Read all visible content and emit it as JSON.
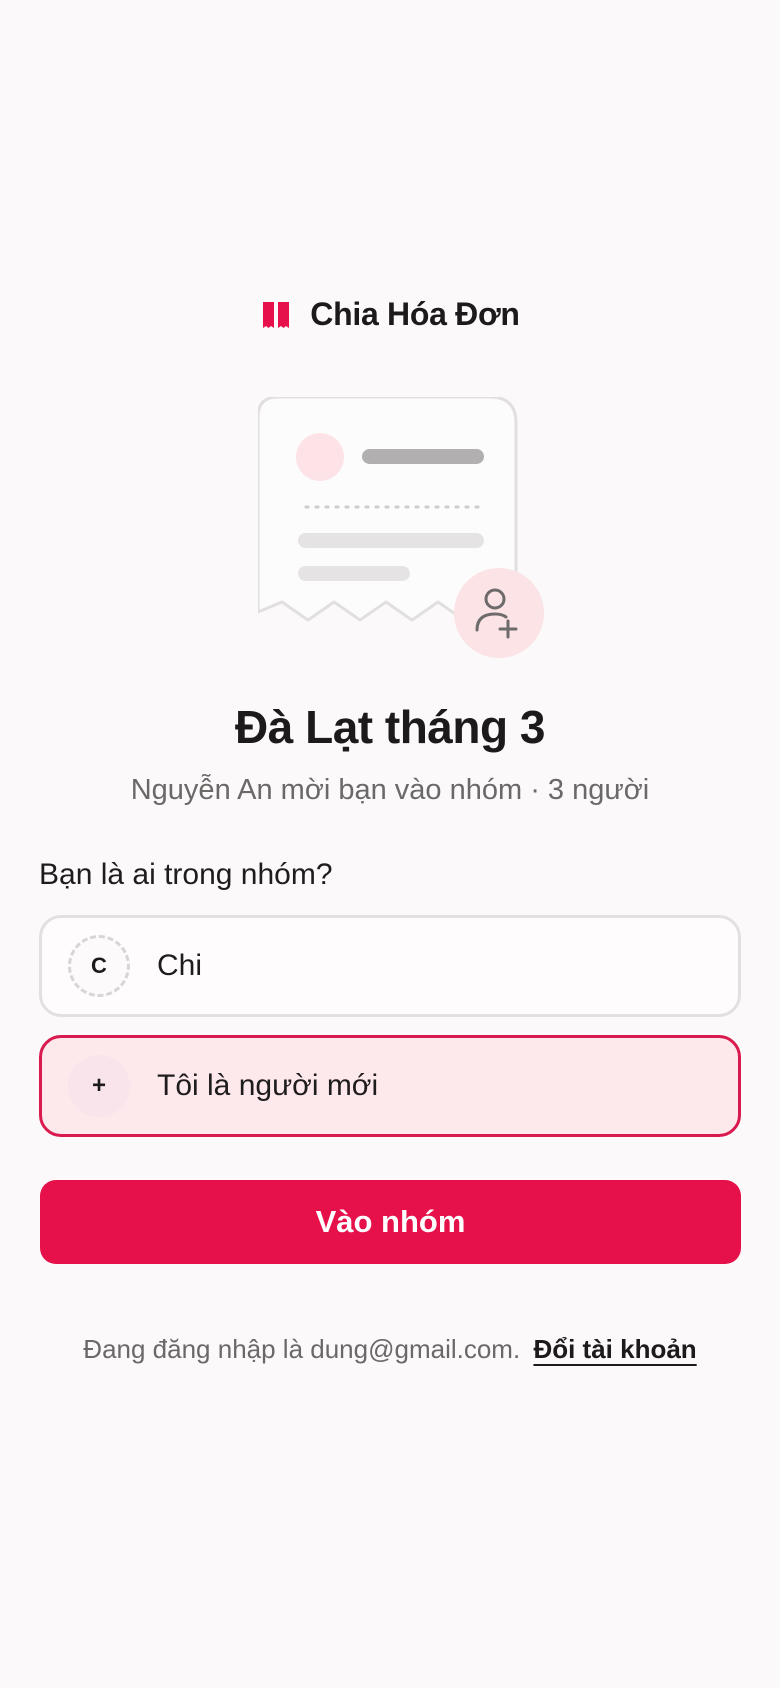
{
  "brand": {
    "name": "Chia Hóa Đơn",
    "icon": "receipt-icon",
    "accent": "#e6104a"
  },
  "illustration": {
    "icon": "add-person-icon"
  },
  "group": {
    "title": "Đà Lạt tháng 3",
    "subtitle": "Nguyễn An mời bạn vào nhóm · 3 người"
  },
  "question": "Bạn là ai trong nhóm?",
  "options": [
    {
      "avatar": "C",
      "label": "Chi",
      "selected": false
    },
    {
      "avatar": "+",
      "label": "Tôi là người mới",
      "selected": true
    }
  ],
  "cta": {
    "label": "Vào nhóm"
  },
  "footer": {
    "text": "Đang đăng nhập là dung@gmail.com.",
    "link": "Đổi tài khoản"
  },
  "colors": {
    "background": "#fbf9fa",
    "primary": "#e6104a",
    "selected_border": "#d91a4f",
    "selected_bg": "#fde8ec"
  }
}
